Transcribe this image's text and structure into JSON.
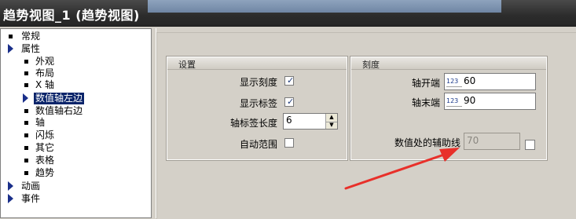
{
  "window": {
    "title": "趋势视图_1 (趋势视图)"
  },
  "tree": {
    "items": [
      {
        "label": "常规"
      },
      {
        "label": "属性"
      },
      {
        "label": "外观"
      },
      {
        "label": "布局"
      },
      {
        "label": "X 轴"
      },
      {
        "label": "数值轴左边"
      },
      {
        "label": "数值轴右边"
      },
      {
        "label": "轴"
      },
      {
        "label": "闪烁"
      },
      {
        "label": "其它"
      },
      {
        "label": "表格"
      },
      {
        "label": "趋势"
      },
      {
        "label": "动画"
      },
      {
        "label": "事件"
      }
    ],
    "selected": "数值轴左边"
  },
  "settings": {
    "title": "设置",
    "show_scale": {
      "label": "显示刻度",
      "checked": true
    },
    "show_labels": {
      "label": "显示标签",
      "checked": true
    },
    "label_length": {
      "label": "轴标签长度",
      "value": "6"
    },
    "auto_range": {
      "label": "自动范围",
      "checked": false
    }
  },
  "scale": {
    "title": "刻度",
    "axis_start": {
      "label": "轴开端",
      "value": "60",
      "icon": "123"
    },
    "axis_end": {
      "label": "轴末端",
      "value": "90",
      "icon": "123"
    },
    "aux_line": {
      "label": "数值处的辅助线",
      "value": "70",
      "checked": false
    }
  },
  "annotation": {
    "arrow_color": "#e8302a"
  },
  "colors": {
    "selection": "#0a246a",
    "titlebar": "#2c2c2c"
  }
}
